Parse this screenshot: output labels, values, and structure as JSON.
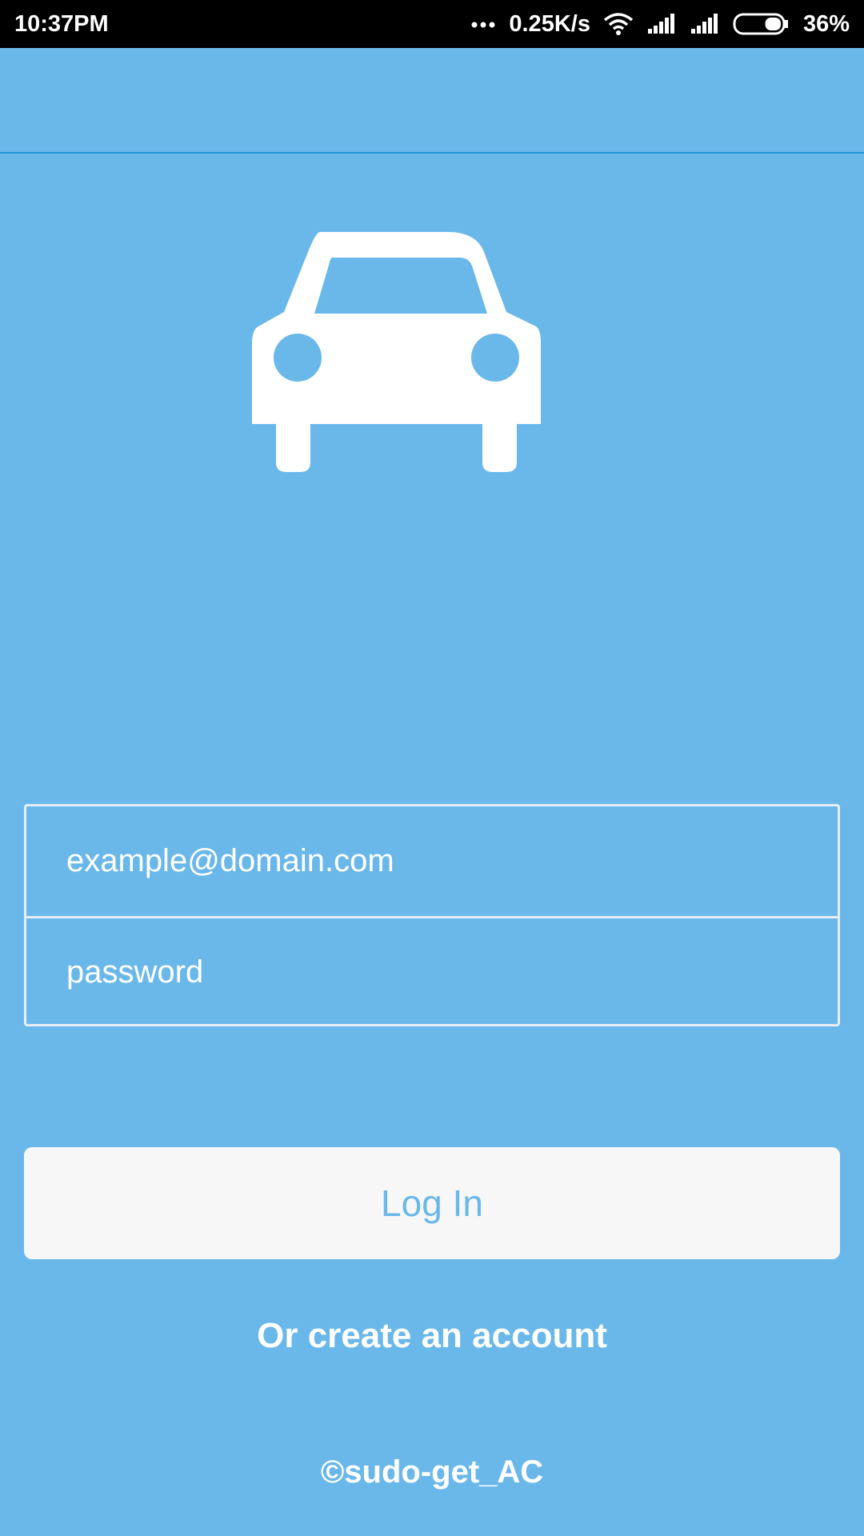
{
  "status_bar": {
    "time": "10:37PM",
    "network_speed": "0.25K/s",
    "battery_percent": "36%",
    "battery_level": 0.36,
    "icons": [
      "more-dots-icon",
      "wifi-icon",
      "signal-icon",
      "signal-icon",
      "battery-icon"
    ]
  },
  "logo": {
    "icon": "car-icon"
  },
  "form": {
    "email_placeholder": "example@domain.com",
    "password_placeholder": "password"
  },
  "actions": {
    "login_label": "Log In",
    "create_account_label": "Or create an account"
  },
  "footer": {
    "copyright": "©sudo-get_AC"
  },
  "colors": {
    "background": "#6ab8ea",
    "appbar_divider": "#1f9ad8",
    "button_bg": "#f7f7f7",
    "button_text": "#6ab8ea"
  }
}
